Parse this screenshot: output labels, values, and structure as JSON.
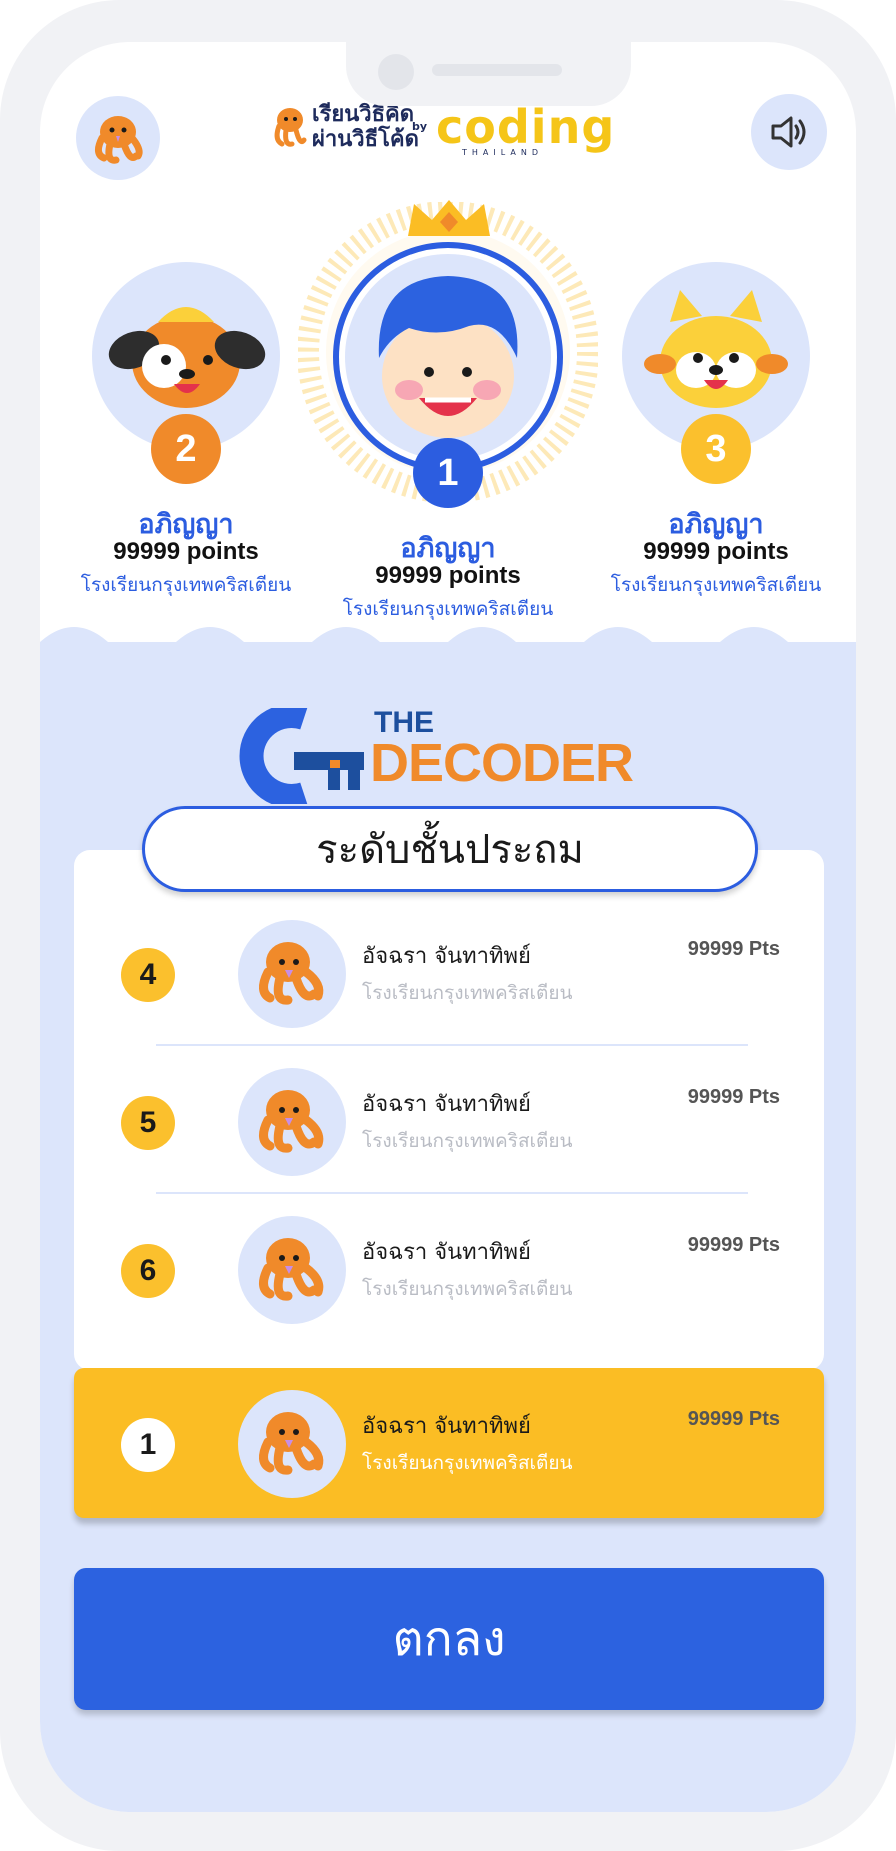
{
  "header": {
    "logo_line1": "เรียนวิธีคิด",
    "logo_line2": "ผ่านวิธีโค้ด",
    "logo_by": "by",
    "logo_brand": "coding",
    "logo_country": "THAILAND",
    "sound_icon": "speaker-icon"
  },
  "podium": [
    {
      "rank": "2",
      "name": "อภิญญา",
      "points": "99999 points",
      "school": "โรงเรียนกรุงเทพคริสเตียน",
      "avatar": "dog-avatar",
      "badge_color": "#f08a2a"
    },
    {
      "rank": "1",
      "name": "อภิญญา",
      "points": "99999 points",
      "school": "โรงเรียนกรุงเทพคริสเตียน",
      "avatar": "boy-avatar",
      "badge_color": "#2c5de0"
    },
    {
      "rank": "3",
      "name": "อภิญญา",
      "points": "99999 points",
      "school": "โรงเรียนกรุงเทพคริสเตียน",
      "avatar": "cat-avatar",
      "badge_color": "#fbc02d"
    }
  ],
  "decoder_logo": {
    "the": "THE",
    "word": "DECODER"
  },
  "level_label": "ระดับชั้นประถม",
  "rows": [
    {
      "rank": "4",
      "name": "อัจฉรา จันทาทิพย์",
      "school": "โรงเรียนกรุงเทพคริสเตียน",
      "points": "99999 Pts"
    },
    {
      "rank": "5",
      "name": "อัจฉรา จันทาทิพย์",
      "school": "โรงเรียนกรุงเทพคริสเตียน",
      "points": "99999 Pts"
    },
    {
      "rank": "6",
      "name": "อัจฉรา จันทาทิพย์",
      "school": "โรงเรียนกรุงเทพคริสเตียน",
      "points": "99999 Pts"
    }
  ],
  "me_row": {
    "rank": "1",
    "name": "อัจฉรา จันทาทิพย์",
    "school": "โรงเรียนกรุงเทพคริสเตียน",
    "points": "99999 Pts"
  },
  "ok_button": "ตกลง",
  "colors": {
    "primary": "#2c5de0",
    "accent": "#fbbd24",
    "background": "#dce5fb"
  }
}
